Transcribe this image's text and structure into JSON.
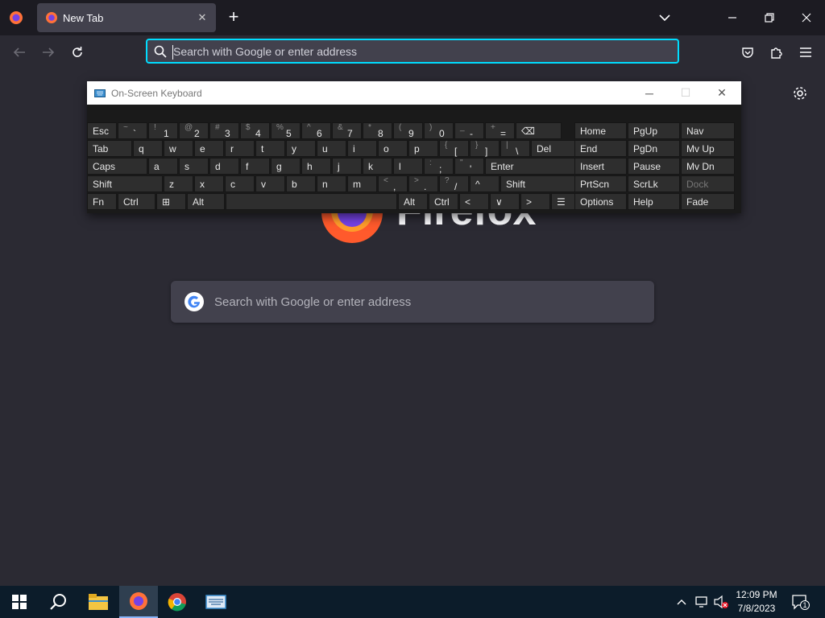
{
  "browser": {
    "tab": {
      "title": "New Tab"
    },
    "urlbar": {
      "placeholder": "Search with Google or enter address"
    }
  },
  "page": {
    "wordmark": "Firefox",
    "search_placeholder": "Search with Google or enter address"
  },
  "osk": {
    "title": "On-Screen Keyboard",
    "rows": [
      [
        {
          "label": "Esc"
        },
        {
          "shift": "~",
          "main": "`"
        },
        {
          "shift": "!",
          "main": "1"
        },
        {
          "shift": "@",
          "main": "2"
        },
        {
          "shift": "#",
          "main": "3"
        },
        {
          "shift": "$",
          "main": "4"
        },
        {
          "shift": "%",
          "main": "5"
        },
        {
          "shift": "^",
          "main": "6"
        },
        {
          "shift": "&",
          "main": "7"
        },
        {
          "shift": "*",
          "main": "8"
        },
        {
          "shift": "(",
          "main": "9"
        },
        {
          "shift": ")",
          "main": "0"
        },
        {
          "shift": "_",
          "main": "-"
        },
        {
          "shift": "+",
          "main": "="
        },
        {
          "label": "⌫"
        },
        {
          "label": "Home"
        },
        {
          "label": "PgUp"
        },
        {
          "label": "Nav"
        }
      ],
      [
        {
          "label": "Tab"
        },
        {
          "label": "q"
        },
        {
          "label": "w"
        },
        {
          "label": "e"
        },
        {
          "label": "r"
        },
        {
          "label": "t"
        },
        {
          "label": "y"
        },
        {
          "label": "u"
        },
        {
          "label": "i"
        },
        {
          "label": "o"
        },
        {
          "label": "p"
        },
        {
          "shift": "{",
          "main": "["
        },
        {
          "shift": "}",
          "main": "]"
        },
        {
          "shift": "|",
          "main": "\\"
        },
        {
          "label": "Del"
        },
        {
          "label": "End"
        },
        {
          "label": "PgDn"
        },
        {
          "label": "Mv Up"
        }
      ],
      [
        {
          "label": "Caps"
        },
        {
          "label": "a"
        },
        {
          "label": "s"
        },
        {
          "label": "d"
        },
        {
          "label": "f"
        },
        {
          "label": "g"
        },
        {
          "label": "h"
        },
        {
          "label": "j"
        },
        {
          "label": "k"
        },
        {
          "label": "l"
        },
        {
          "shift": ":",
          "main": ";"
        },
        {
          "shift": "\"",
          "main": "'"
        },
        {
          "label": "Enter"
        },
        {
          "label": "Insert"
        },
        {
          "label": "Pause"
        },
        {
          "label": "Mv Dn"
        }
      ],
      [
        {
          "label": "Shift"
        },
        {
          "label": "z"
        },
        {
          "label": "x"
        },
        {
          "label": "c"
        },
        {
          "label": "v"
        },
        {
          "label": "b"
        },
        {
          "label": "n"
        },
        {
          "label": "m"
        },
        {
          "shift": "<",
          "main": ","
        },
        {
          "shift": ">",
          "main": "."
        },
        {
          "shift": "?",
          "main": "/"
        },
        {
          "label": "^"
        },
        {
          "label": "Shift"
        },
        {
          "label": "PrtScn"
        },
        {
          "label": "ScrLk"
        },
        {
          "label": "Dock",
          "dim": true
        }
      ],
      [
        {
          "label": "Fn"
        },
        {
          "label": "Ctrl"
        },
        {
          "label": "⊞"
        },
        {
          "label": "Alt"
        },
        {
          "label": ""
        },
        {
          "label": "Alt"
        },
        {
          "label": "Ctrl"
        },
        {
          "label": "<"
        },
        {
          "label": "∨"
        },
        {
          "label": ">"
        },
        {
          "label": "☰"
        },
        {
          "label": "Options"
        },
        {
          "label": "Help"
        },
        {
          "label": "Fade"
        }
      ]
    ]
  },
  "taskbar": {
    "time": "12:09 PM",
    "date": "7/8/2023",
    "notification_count": "1"
  },
  "colors": {
    "accent": "#00ddff",
    "tabstrip": "#1c1b22",
    "toolbar": "#2b2a33",
    "field": "#42414d"
  }
}
